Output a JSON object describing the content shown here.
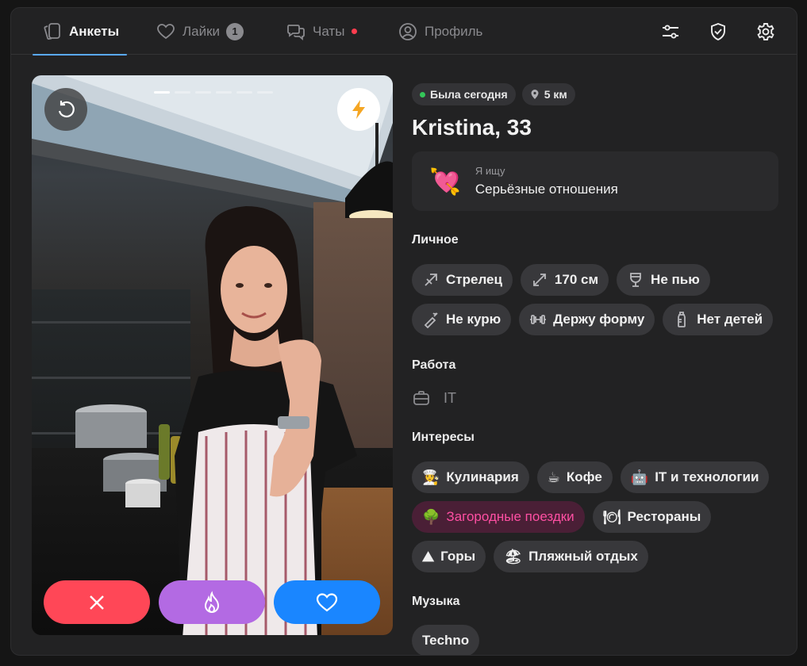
{
  "nav": {
    "tabs": [
      {
        "label": "Анкеты"
      },
      {
        "label": "Лайки",
        "badge": "1"
      },
      {
        "label": "Чаты"
      },
      {
        "label": "Профиль"
      }
    ]
  },
  "profile": {
    "status": "Была сегодня",
    "distance": "5 км",
    "name": "Kristina, 33",
    "looking_for": {
      "label": "Я ищу",
      "value": "Серьёзные отношения",
      "emoji": "💘"
    },
    "personal": {
      "title": "Личное",
      "items": [
        {
          "label": "Стрелец",
          "icon": "sagittarius-icon"
        },
        {
          "label": "170 см",
          "icon": "height-icon"
        },
        {
          "label": "Не пью",
          "icon": "wine-glass-icon"
        },
        {
          "label": "Не курю",
          "icon": "no-smoking-icon"
        },
        {
          "label": "Держу форму",
          "icon": "dumbbell-icon"
        },
        {
          "label": "Нет детей",
          "icon": "baby-bottle-icon"
        }
      ]
    },
    "work": {
      "title": "Работа",
      "value": "IT",
      "icon": "briefcase-icon"
    },
    "interests": {
      "title": "Интересы",
      "items": [
        {
          "label": "Кулинария",
          "emoji": "👩‍🍳"
        },
        {
          "label": "Кофе",
          "emoji": "☕"
        },
        {
          "label": "IT и технологии",
          "emoji": "🤖"
        },
        {
          "label": "Загородные поездки",
          "emoji": "🌳"
        },
        {
          "label": "Рестораны",
          "emoji": "🍽"
        },
        {
          "label": "Горы",
          "emoji": "⛰"
        },
        {
          "label": "Пляжный отдых",
          "emoji": "🏖"
        }
      ]
    },
    "music": {
      "title": "Музыка",
      "items": [
        {
          "label": "Techno"
        }
      ]
    }
  },
  "colors": {
    "accent_blue": "#1a86ff",
    "dislike_red": "#ff4757",
    "superlike_purple": "#b36ae3",
    "highlight_pink": "#ff4fa3",
    "online_green": "#34c759"
  }
}
